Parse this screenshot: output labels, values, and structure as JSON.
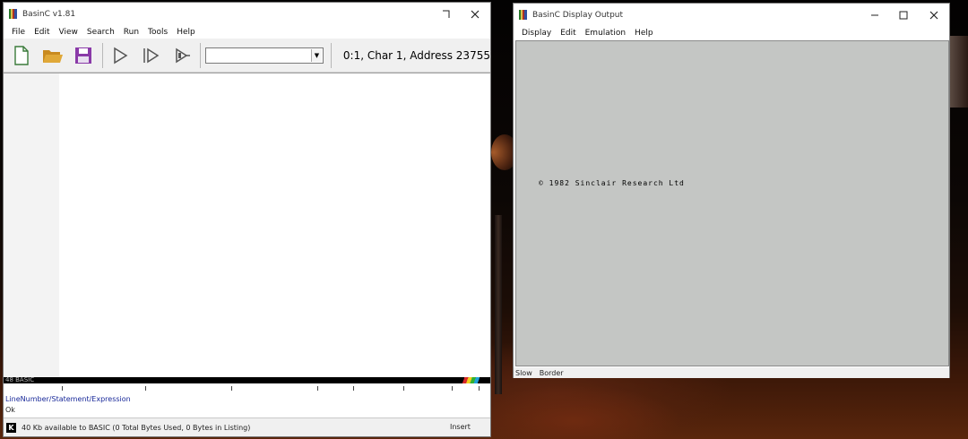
{
  "editor_window": {
    "title": "BasinC v1.81",
    "menu": [
      "File",
      "Edit",
      "View",
      "Search",
      "Run",
      "Tools",
      "Help"
    ],
    "toolbar": {
      "buttons": [
        "new-icon",
        "open-folder-icon",
        "save-icon",
        "run-icon",
        "step-icon",
        "trace-icon"
      ],
      "combo_value": "",
      "position_text": "0:1, Char 1, Address 23755"
    },
    "ruler_label": "48 BASIC",
    "info": {
      "line1": "LineNumber/Statement/Expression",
      "line2": "Ok"
    },
    "status": {
      "mode_key": "K",
      "memory_text": "40 Kb available to BASIC (0 Total Bytes Used, 0 Bytes in Listing)",
      "insert_mode": "Insert"
    }
  },
  "display_window": {
    "title": "BasinC Display Output",
    "menu": [
      "Display",
      "Edit",
      "Emulation",
      "Help"
    ],
    "screen_text": "© 1982 Sinclair Research Ltd",
    "status": [
      "Slow",
      "Border"
    ]
  },
  "colors": {
    "spectrum_paper": "#c4c6c4",
    "save_icon": "#8a3aa8",
    "folder_icon": "#e0a838",
    "info_text": "#1a2a9a"
  }
}
